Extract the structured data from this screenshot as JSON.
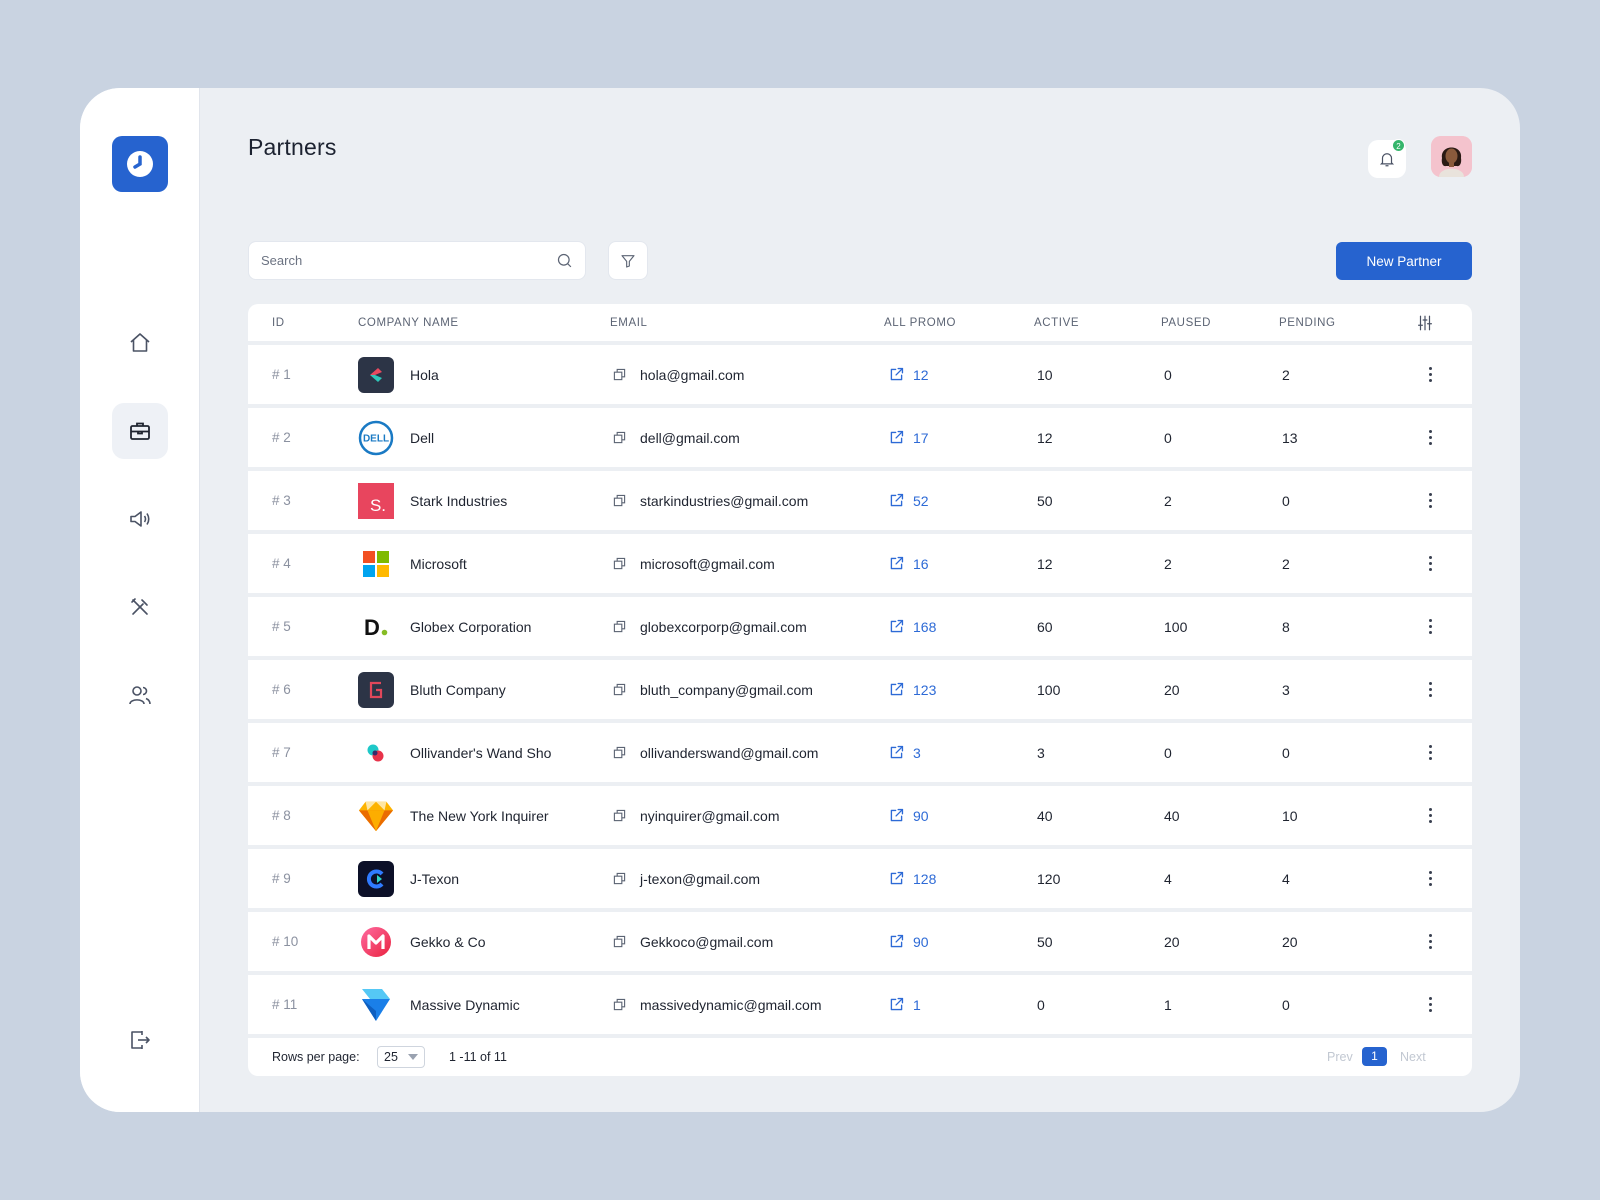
{
  "page": {
    "title": "Partners"
  },
  "header": {
    "notification_count": "2"
  },
  "search": {
    "placeholder": "Search",
    "value": ""
  },
  "toolbar": {
    "new_partner_label": "New Partner"
  },
  "sidebar": {
    "items": [
      {
        "icon": "home-icon",
        "active": false
      },
      {
        "icon": "briefcase-icon",
        "active": true
      },
      {
        "icon": "megaphone-icon",
        "active": false
      },
      {
        "icon": "tools-icon",
        "active": false
      },
      {
        "icon": "users-icon",
        "active": false
      }
    ],
    "logout_icon": "logout-icon"
  },
  "table": {
    "headers": {
      "id": "ID",
      "company": "COMPANY NAME",
      "email": "EMAIL",
      "promo": "ALL PROMO",
      "active": "ACTIVE",
      "paused": "PAUSED",
      "pending": "PENDING"
    },
    "rows": [
      {
        "id": "# 1",
        "company": "Hola",
        "email": "hola@gmail.com",
        "promo": "12",
        "active": "10",
        "paused": "0",
        "pending": "2",
        "logo": "hola"
      },
      {
        "id": "# 2",
        "company": "Dell",
        "email": "dell@gmail.com",
        "promo": "17",
        "active": "12",
        "paused": "0",
        "pending": "13",
        "logo": "dell"
      },
      {
        "id": "# 3",
        "company": "Stark Industries",
        "email": "starkindustries@gmail.com",
        "promo": "52",
        "active": "50",
        "paused": "2",
        "pending": "0",
        "logo": "stark"
      },
      {
        "id": "# 4",
        "company": "Microsoft",
        "email": "microsoft@gmail.com",
        "promo": "16",
        "active": "12",
        "paused": "2",
        "pending": "2",
        "logo": "microsoft"
      },
      {
        "id": "# 5",
        "company": "Globex Corporation",
        "email": "globexcorporp@gmail.com",
        "promo": "168",
        "active": "60",
        "paused": "100",
        "pending": "8",
        "logo": "globex"
      },
      {
        "id": "# 6",
        "company": "Bluth Company",
        "email": "bluth_company@gmail.com",
        "promo": "123",
        "active": "100",
        "paused": "20",
        "pending": "3",
        "logo": "bluth"
      },
      {
        "id": "# 7",
        "company": "Ollivander's Wand Sho",
        "email": "ollivanderswand@gmail.com",
        "promo": "3",
        "active": "3",
        "paused": "0",
        "pending": "0",
        "logo": "ollivander"
      },
      {
        "id": "# 8",
        "company": "The New York Inquirer",
        "email": "nyinquirer@gmail.com",
        "promo": "90",
        "active": "40",
        "paused": "40",
        "pending": "10",
        "logo": "nyinquirer"
      },
      {
        "id": "# 9",
        "company": "J-Texon",
        "email": "j-texon@gmail.com",
        "promo": "128",
        "active": "120",
        "paused": "4",
        "pending": "4",
        "logo": "jtexon"
      },
      {
        "id": "# 10",
        "company": "Gekko & Co",
        "email": "Gekkoco@gmail.com",
        "promo": "90",
        "active": "50",
        "paused": "20",
        "pending": "20",
        "logo": "gekko"
      },
      {
        "id": "# 11",
        "company": "Massive Dynamic",
        "email": "massivedynamic@gmail.com",
        "promo": "1",
        "active": "0",
        "paused": "1",
        "pending": "0",
        "logo": "massive"
      }
    ]
  },
  "footer": {
    "rows_per_page_label": "Rows per page:",
    "rows_per_page_value": "25",
    "range": "1 -11 of 11",
    "prev": "Prev",
    "current_page": "1",
    "next": "Next"
  },
  "colors": {
    "accent": "#2663cf",
    "link": "#2d6ad6",
    "badge": "#35b56b"
  }
}
